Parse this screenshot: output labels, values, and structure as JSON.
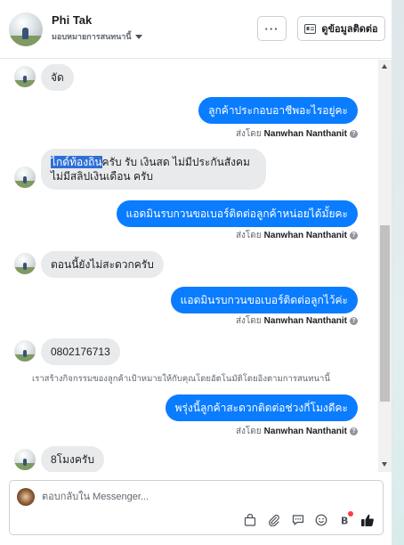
{
  "header": {
    "contact_name": "Phi Tak",
    "assign_label": "มอบหมายการสนทนานี้",
    "more_label": "···",
    "details_label": "ดูข้อมูลติดต่อ"
  },
  "messages": [
    {
      "dir": "in",
      "text": "จัด"
    },
    {
      "dir": "out",
      "text": "ลูกค้าประกอบอาชีพอะไรอยู่คะ",
      "sent_by_label": "ส่งโดย",
      "sent_by": "Nanwhan Nanthanit"
    },
    {
      "dir": "in",
      "highlight": "ไกด์ท้องถิ่น",
      "text_rest": "ครับ รับ เงินสด ไม่มีประกันสังคม",
      "text_line2": "ไม่มีสลิปเงินเดือน ครับ"
    },
    {
      "dir": "out",
      "text": "แอดมินรบกวนขอเบอร์ติดต่อลูกค้าหน่อยได้มั้ยคะ",
      "sent_by_label": "ส่งโดย",
      "sent_by": "Nanwhan Nanthanit"
    },
    {
      "dir": "in",
      "text": "ตอนนี้ยังไม่สะดวกครับ"
    },
    {
      "dir": "out",
      "text": "แอดมินรบกวนขอเบอร์ติดต่อลูกไว้ค่ะ",
      "sent_by_label": "ส่งโดย",
      "sent_by": "Nanwhan Nanthanit"
    },
    {
      "dir": "in",
      "text": "0802176713"
    },
    {
      "dir": "system",
      "text": "เราสร้างกิจกรรมของลูกค้าเป้าหมายให้กับคุณโดยอัตโนมัติโดยอิงตามการสนทนานี้"
    },
    {
      "dir": "out",
      "text": "พรุ่งนี้ลูกค้าสะดวกติดต่อช่วงกี่โมงดีคะ",
      "sent_by_label": "ส่งโดย",
      "sent_by": "Nanwhan Nanthanit"
    },
    {
      "dir": "in",
      "text": "8โมงครับ"
    }
  ],
  "composer": {
    "placeholder": "ตอบกลับใน Messenger...",
    "value": ""
  },
  "toolbar_icons": [
    "shopping-bag-icon",
    "paperclip-icon",
    "saved-reply-icon",
    "emoji-icon",
    "crypto-icon",
    "thumbs-up-icon"
  ],
  "colors": {
    "outgoing_bubble": "#0a7cff",
    "incoming_bubble": "#e9eaeb",
    "like_icon": "#1c1e21",
    "badge": "#fa3e3e"
  }
}
